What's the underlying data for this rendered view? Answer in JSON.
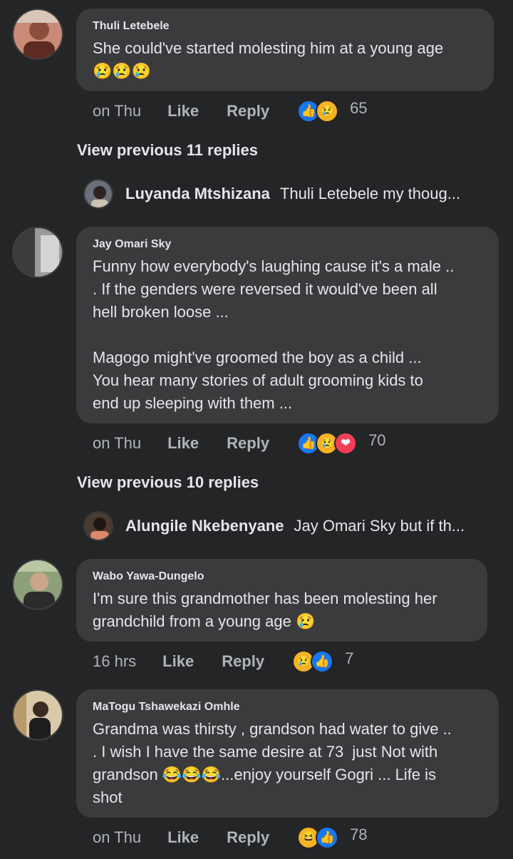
{
  "comments": [
    {
      "author": "Thuli Letebele",
      "text": "She could've started molesting him at a young age",
      "emoji_line": "😢😢😢",
      "time": "on Thu",
      "like": "Like",
      "reply": "Reply",
      "reactions": [
        "like-reaction",
        "sad-reaction"
      ],
      "count": "65",
      "view_previous": "View previous 11 replies",
      "preview_author": "Luyanda Mtshizana",
      "preview_text": "Thuli Letebele my thoug..."
    },
    {
      "author": "Jay Omari Sky",
      "text": "Funny how everybody's laughing cause it's a male ..\n. If the genders were reversed it would've been all\nhell broken loose ...\n\nMagogo might've groomed the boy as a child ...\nYou hear many stories of adult grooming kids to\nend up sleeping with them ...",
      "time": "on Thu",
      "like": "Like",
      "reply": "Reply",
      "reactions": [
        "like-reaction",
        "sad-reaction",
        "love-reaction"
      ],
      "count": "70",
      "view_previous": "View previous 10 replies",
      "preview_author": "Alungile Nkebenyane",
      "preview_text": "Jay Omari Sky but if th..."
    },
    {
      "author": "Wabo Yawa-Dungelo",
      "text": "I'm sure this grandmother has been molesting her\ngrandchild from a young age 😢",
      "time": "16 hrs",
      "like": "Like",
      "reply": "Reply",
      "reactions": [
        "sad-reaction",
        "like-reaction"
      ],
      "count": "7"
    },
    {
      "author": "MaTogu Tshawekazi Omhle",
      "text": "Grandma was thirsty , grandson had water to give ..\n. I wish I have the same desire at 73  just Not with\ngrandson 😂😂😂...enjoy yourself Gogri ... Life is\nshot",
      "time": "on Thu",
      "like": "Like",
      "reply": "Reply",
      "reactions": [
        "haha-reaction",
        "like-reaction"
      ],
      "count": "78"
    }
  ],
  "colors": {
    "background": "#242526",
    "bubble": "#3a3b3c",
    "text": "#e4e6eb",
    "muted": "#b0b3b8",
    "like_blue": "#1877f2",
    "love_red": "#f33e58",
    "emoji_yellow": "#f7b125"
  }
}
